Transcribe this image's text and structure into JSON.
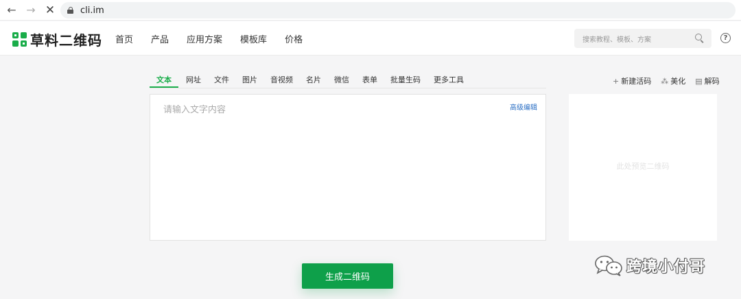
{
  "browser": {
    "url": "cli.im"
  },
  "header": {
    "logo_text": "草料二维码",
    "nav": [
      "首页",
      "产品",
      "应用方案",
      "模板库",
      "价格"
    ],
    "search_placeholder": "搜索教程、模板、方案"
  },
  "tabs": {
    "items": [
      "文本",
      "网址",
      "文件",
      "图片",
      "音视频",
      "名片",
      "微信",
      "表单",
      "批量生码",
      "更多工具"
    ],
    "active": "文本"
  },
  "tools": {
    "new_code": "新建活码",
    "beautify": "美化",
    "decode": "解码"
  },
  "editor": {
    "placeholder": "请输入文字内容",
    "advanced_edit": "高级编辑"
  },
  "preview": {
    "placeholder": "此处预览二维码"
  },
  "generate_button": "生成二维码",
  "watermark": "跨境小付哥",
  "colors": {
    "brand_green": "#1aad4a",
    "button_green": "#0ea04a",
    "link_blue": "#2b6fc4"
  }
}
